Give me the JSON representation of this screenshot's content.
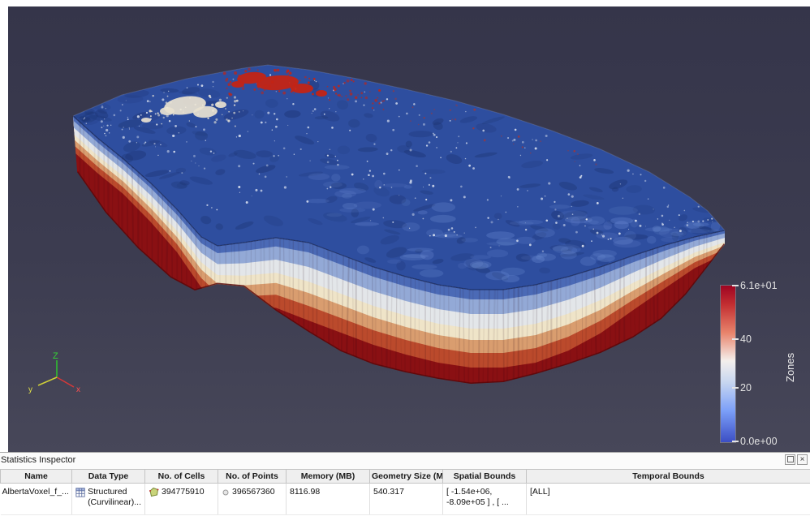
{
  "legend": {
    "title": "Zones",
    "ticks": [
      "6.1e+01",
      "40",
      "20",
      "0.0e+00"
    ],
    "color_top": "#b40426",
    "color_mid": "#f7f7f7",
    "color_bottom": "#3b4cc0"
  },
  "axes": {
    "x": "x",
    "y": "y",
    "z": "Z"
  },
  "panel": {
    "title": "Statistics Inspector",
    "close_glyph": "×",
    "columns": [
      "Name",
      "Data Type",
      "No. of Cells",
      "No. of Points",
      "Memory (MB)",
      "Geometry Size (MB)",
      "Spatial Bounds",
      "Temporal Bounds"
    ],
    "row": {
      "name": "AlbertaVoxel_f_...",
      "data_type_line1": "Structured",
      "data_type_line2": "(Curvilinear)...",
      "cells": "394775910",
      "points": "396567360",
      "memory": "8116.98",
      "geometry_size": "540.317",
      "spatial_line1": "[ -1.54e+06,",
      "spatial_line2": "-8.09e+05 ] , [ ...",
      "temporal": "[ALL]"
    }
  }
}
